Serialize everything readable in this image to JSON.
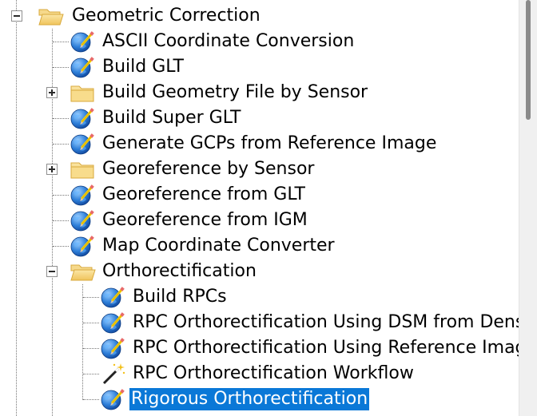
{
  "tree": {
    "parent": {
      "label": "Geometric Correction",
      "icon": "folder-open-icon"
    },
    "items": [
      {
        "label": "ASCII Coordinate Conversion",
        "icon": "globe-pencil-icon"
      },
      {
        "label": "Build GLT",
        "icon": "globe-pencil-icon"
      },
      {
        "label": "Build Geometry File by Sensor",
        "icon": "folder-icon"
      },
      {
        "label": "Build Super GLT",
        "icon": "globe-pencil-icon"
      },
      {
        "label": "Generate GCPs from Reference Image",
        "icon": "globe-pencil-icon"
      },
      {
        "label": "Georeference by Sensor",
        "icon": "folder-icon"
      },
      {
        "label": "Georeference from GLT",
        "icon": "globe-pencil-icon"
      },
      {
        "label": "Georeference from IGM",
        "icon": "globe-pencil-icon"
      },
      {
        "label": "Map Coordinate Converter",
        "icon": "globe-pencil-icon"
      },
      {
        "label": "Orthorectification",
        "icon": "folder-open-icon"
      }
    ],
    "ortho_children": [
      {
        "label": "Build RPCs",
        "icon": "globe-pencil-icon"
      },
      {
        "label": "RPC Orthorectification Using DSM from Dense",
        "icon": "globe-pencil-icon"
      },
      {
        "label": "RPC Orthorectification Using Reference Image",
        "icon": "globe-pencil-icon"
      },
      {
        "label": "RPC Orthorectification Workflow",
        "icon": "magic-wand-icon"
      },
      {
        "label": "Rigorous Orthorectification",
        "icon": "globe-pencil-icon",
        "selected": true
      }
    ]
  },
  "colors": {
    "selection": "#0a78d7",
    "folder": "#f4d27d"
  }
}
